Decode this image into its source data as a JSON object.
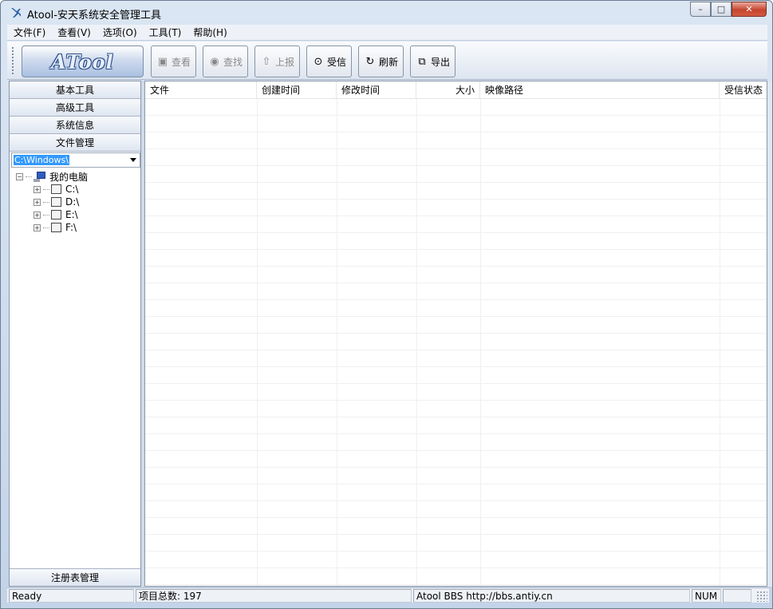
{
  "window": {
    "title": "Atool-安天系统安全管理工具",
    "buttons": {
      "minimize": "–",
      "maximize": "□",
      "close": "✕"
    }
  },
  "menubar": {
    "items": [
      {
        "label": "文件(F)"
      },
      {
        "label": "查看(V)"
      },
      {
        "label": "选项(O)"
      },
      {
        "label": "工具(T)"
      },
      {
        "label": "帮助(H)"
      }
    ]
  },
  "toolbar": {
    "logo_text": "ATool",
    "buttons": [
      {
        "label": "查看",
        "icon": "view-icon",
        "glyph": "▣",
        "enabled": false
      },
      {
        "label": "查找",
        "icon": "find-icon",
        "glyph": "◉",
        "enabled": false
      },
      {
        "label": "上报",
        "icon": "upload-icon",
        "glyph": "⇧",
        "enabled": false
      },
      {
        "label": "受信",
        "icon": "trust-icon",
        "glyph": "⊙",
        "enabled": true
      },
      {
        "label": "刷新",
        "icon": "refresh-icon",
        "glyph": "↻",
        "enabled": true
      },
      {
        "label": "导出",
        "icon": "export-icon",
        "glyph": "⧉",
        "enabled": true
      }
    ]
  },
  "sidebar": {
    "nav": [
      {
        "label": "基本工具"
      },
      {
        "label": "高级工具"
      },
      {
        "label": "系统信息"
      },
      {
        "label": "文件管理"
      }
    ],
    "path_value": "C:\\Windows\\",
    "tree": {
      "root": {
        "label": "我的电脑",
        "expander": "−"
      },
      "drives": [
        {
          "label": "C:\\",
          "expander": "+"
        },
        {
          "label": "D:\\",
          "expander": "+"
        },
        {
          "label": "E:\\",
          "expander": "+"
        },
        {
          "label": "F:\\",
          "expander": "+"
        }
      ]
    },
    "bottom_button": "注册表管理"
  },
  "listview": {
    "columns": [
      {
        "label": "文件",
        "align": "left"
      },
      {
        "label": "创建时间",
        "align": "left"
      },
      {
        "label": "修改时间",
        "align": "left"
      },
      {
        "label": "大小",
        "align": "right"
      },
      {
        "label": "映像路径",
        "align": "left"
      },
      {
        "label": "受信状态",
        "align": "left"
      }
    ],
    "rows": []
  },
  "statusbar": {
    "ready": "Ready",
    "count": "项目总数: 197",
    "bbs": "Atool BBS http://bbs.antiy.cn",
    "num": "NUM"
  },
  "colors": {
    "frame": "#c3d3e8",
    "selection": "#3399ff",
    "logo_outline": "#2c4e88"
  }
}
